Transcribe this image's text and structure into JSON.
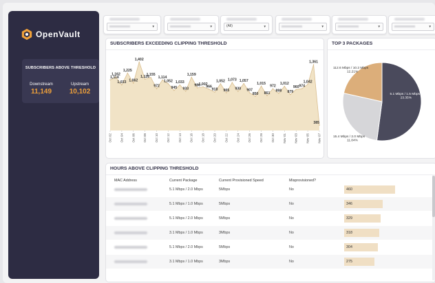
{
  "app": {
    "name": "OpenVault",
    "accent": "#f0a13a",
    "sidebar_bg": "#2d2c43"
  },
  "threshold": {
    "title": "SUBSCRIBERS ABOVE THRESHOLD",
    "downstream_label": "Downstream",
    "downstream_value": "11,149",
    "upstream_label": "Upstream",
    "upstream_value": "10,102"
  },
  "filters": [
    {
      "value": ""
    },
    {
      "value": ""
    },
    {
      "value": "(All)"
    },
    {
      "value": ""
    },
    {
      "value": ""
    },
    {
      "value": ""
    }
  ],
  "clipping_panel": {
    "title": "SUBSCRIBERS EXCEEDING CLIPPING THRESHOLD"
  },
  "packages_panel": {
    "title": "TOP 3 PACKAGES"
  },
  "hours_panel": {
    "title": "HOURS ABOVE CLIPPING THRESHOLD"
  },
  "chart_data": [
    {
      "type": "area",
      "title": "SUBSCRIBERS EXCEEDING CLIPPING THRESHOLD",
      "x_ticks": [
        "Oct 02",
        "Oct 04",
        "Oct 06",
        "Oct 08",
        "Oct 10",
        "Oct 12",
        "Oct 14",
        "Oct 16",
        "Oct 18",
        "Oct 20",
        "Oct 22",
        "Oct 24",
        "Oct 26",
        "Oct 28",
        "Oct 30",
        "Nov 01",
        "Nov 03",
        "Nov 05",
        "Nov 07"
      ],
      "values": [
        1114,
        1162,
        1033,
        1225,
        1062,
        1402,
        1126,
        1155,
        972,
        1114,
        1052,
        945,
        1033,
        933,
        1159,
        986,
        1002,
        966,
        918,
        1052,
        905,
        1073,
        930,
        1057,
        907,
        850,
        1015,
        861,
        972,
        898,
        1012,
        879,
        960,
        974,
        1042,
        1361,
        385
      ],
      "fill": "#f1e3c6",
      "stroke": "#d9bd8e"
    },
    {
      "type": "pie",
      "title": "TOP 3 PACKAGES",
      "slices": [
        {
          "label": "5.1 Mbps / 1.5 Mbps",
          "pct": "23.35%",
          "value": 52.1,
          "color": "#4a4a5c"
        },
        {
          "label": "15.4 Mbps / 2.0 Mbps",
          "pct": "11.84%",
          "value": 26.4,
          "color": "#d6d6d9"
        },
        {
          "label": "112.6 Mbps / 10.2 Mbps",
          "pct": "12.21%",
          "value": 21.5,
          "color": "#dcae7a"
        }
      ]
    }
  ],
  "hours_table": {
    "headers": {
      "mac": "MAC Address",
      "package": "Current Package",
      "speed": "Current Provisioned Speed",
      "misprov": "Misprovisioned?"
    },
    "rows": [
      {
        "package": "5.1 Mbps / 2.0 Mbps",
        "speed": "5Mbps",
        "misprov": "No",
        "hours": 460
      },
      {
        "package": "5.1 Mbps / 1.0 Mbps",
        "speed": "5Mbps",
        "misprov": "No",
        "hours": 346
      },
      {
        "package": "5.1 Mbps / 2.0 Mbps",
        "speed": "5Mbps",
        "misprov": "No",
        "hours": 329
      },
      {
        "package": "3.1 Mbps / 1.0 Mbps",
        "speed": "3Mbps",
        "misprov": "No",
        "hours": 318
      },
      {
        "package": "5.1 Mbps / 2.0 Mbps",
        "speed": "5Mbps",
        "misprov": "No",
        "hours": 304
      },
      {
        "package": "3.1 Mbps / 1.0 Mbps",
        "speed": "3Mbps",
        "misprov": "No",
        "hours": 275
      }
    ],
    "bar_color": "#f0dfc4",
    "max_hours": 460
  }
}
